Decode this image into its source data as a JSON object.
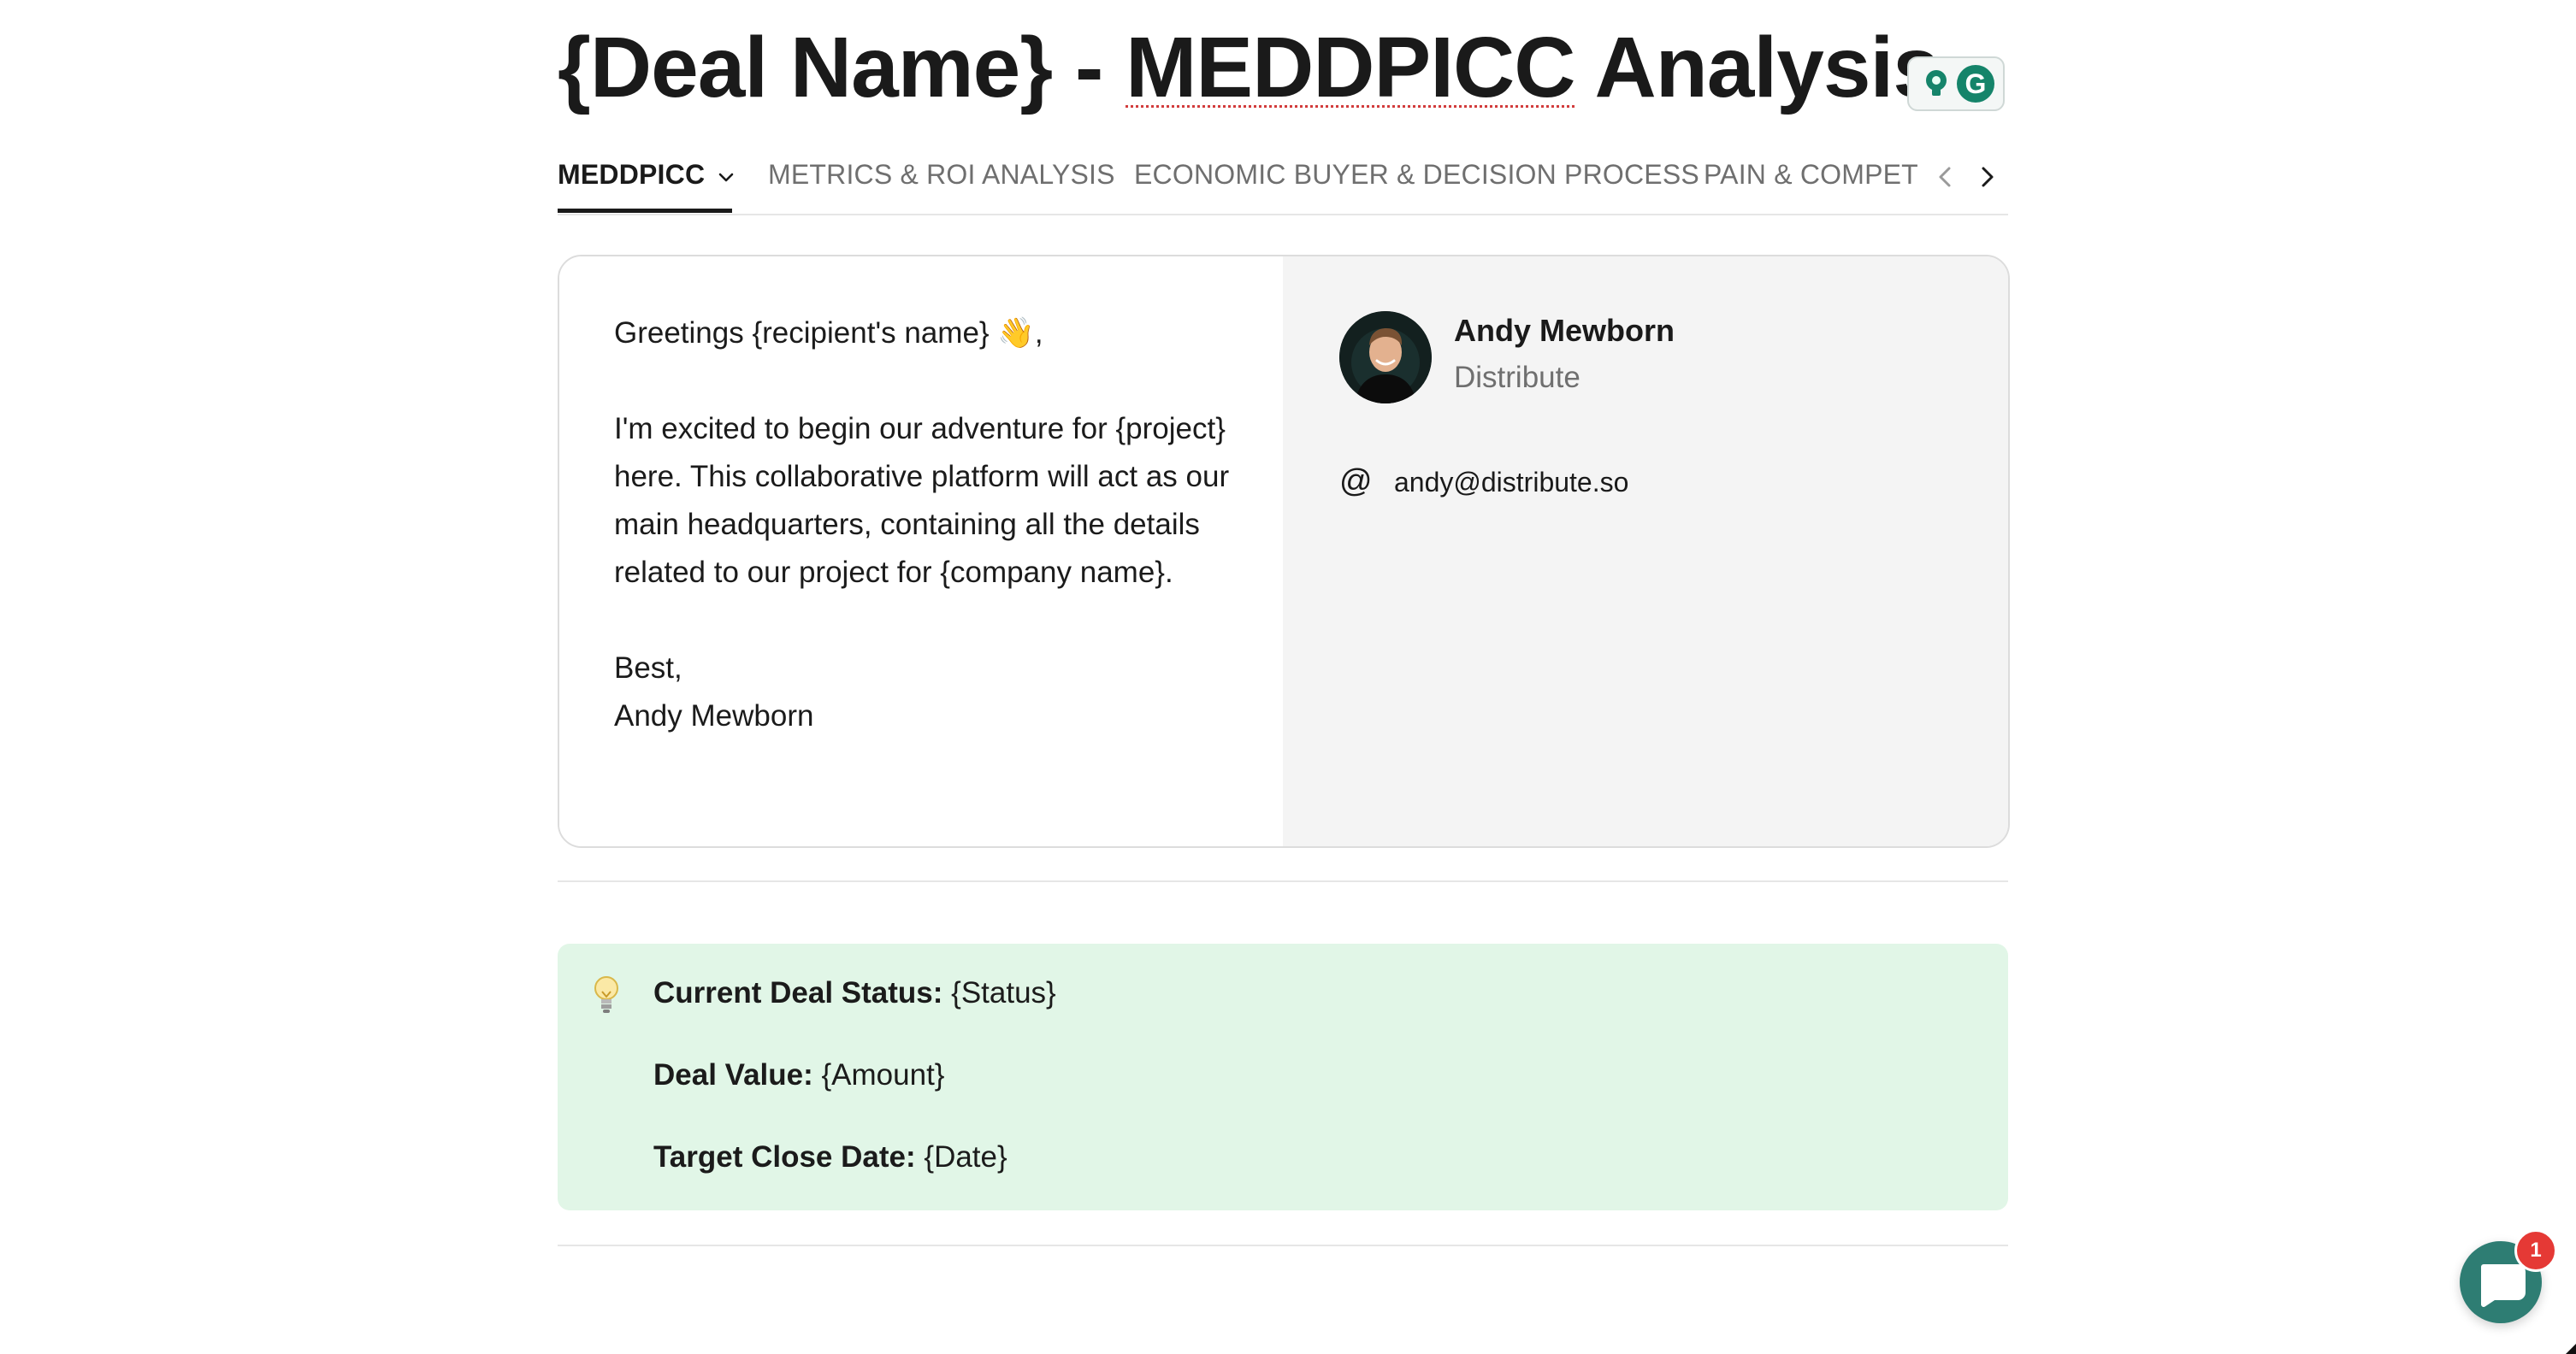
{
  "title": {
    "prefix": "{Deal Name} - ",
    "highlighted_word": "MEDDPICC",
    "suffix": " Analysis"
  },
  "extension": {
    "icon_names": [
      "lightbulb-icon",
      "grammarly-icon"
    ],
    "grammarly_letter": "G",
    "accent_color": "#15846a"
  },
  "tabs": [
    {
      "label": "MEDDPICC",
      "active": true
    },
    {
      "label": "METRICS & ROI ANALYSIS",
      "active": false
    },
    {
      "label": "ECONOMIC BUYER & DECISION PROCESS",
      "active": false
    },
    {
      "label": "PAIN & COMPET",
      "active": false
    }
  ],
  "letter": {
    "greeting": "Greetings {recipient's name} 👋,",
    "body": "I'm excited to begin our adventure for {project} here. This collaborative platform will act as our main headquarters, containing all the details related to our project for {company name}.",
    "closing": "Best,",
    "signature": "Andy Mewborn"
  },
  "author": {
    "name": "Andy Mewborn",
    "company": "Distribute",
    "email_icon": "@",
    "email": "andy@distribute.so"
  },
  "callout": {
    "icon": "lightbulb-icon",
    "background_color": "#e1f6e7",
    "lines": [
      {
        "label": "Current Deal Status:",
        "value": " {Status}"
      },
      {
        "label": "Deal Value:",
        "value": " {Amount}"
      },
      {
        "label": "Target Close Date:",
        "value": " {Date}"
      }
    ]
  },
  "chat_widget": {
    "icon": "chat-bubble-icon",
    "badge_count": "1",
    "color": "#2e7d73"
  }
}
